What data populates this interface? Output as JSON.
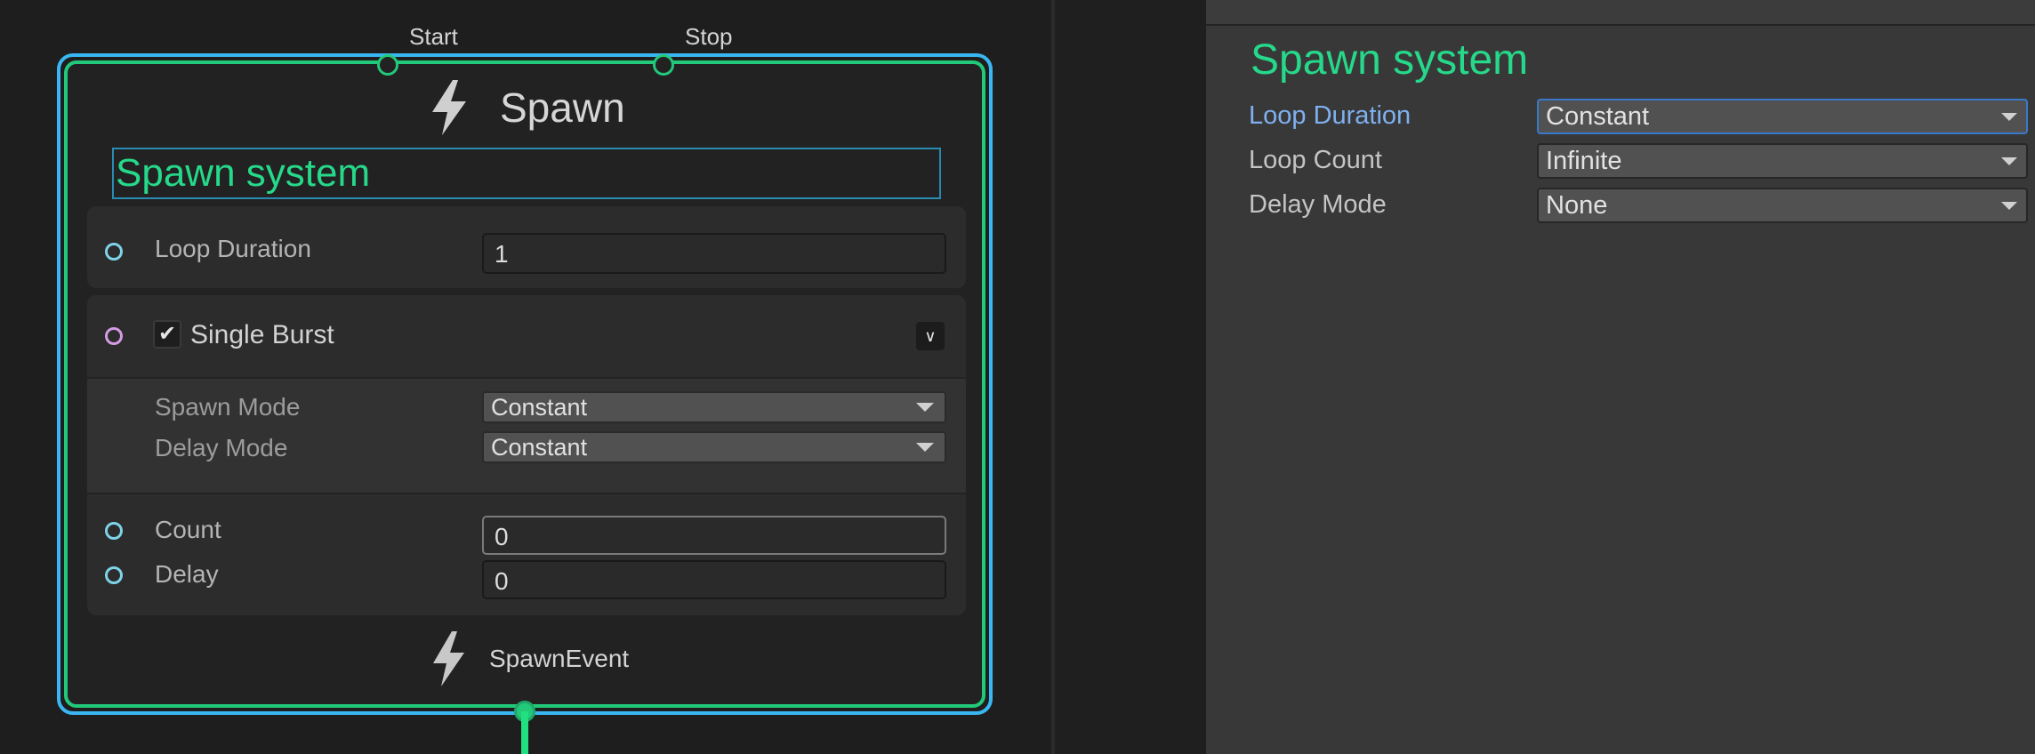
{
  "node": {
    "ports": {
      "start_label": "Start",
      "stop_label": "Stop"
    },
    "title": "Spawn",
    "system_name": "Spawn system",
    "loop_duration": {
      "label": "Loop Duration",
      "value": "1"
    },
    "burst": {
      "label": "Single Burst",
      "checked": true,
      "spawn_mode": {
        "label": "Spawn Mode",
        "value": "Constant"
      },
      "delay_mode": {
        "label": "Delay Mode",
        "value": "Constant"
      },
      "count": {
        "label": "Count",
        "value": "0"
      },
      "delay": {
        "label": "Delay",
        "value": "0"
      }
    },
    "output_label": "SpawnEvent"
  },
  "inspector": {
    "title": "Spawn system",
    "rows": [
      {
        "label": "Loop Duration",
        "value": "Constant"
      },
      {
        "label": "Loop Count",
        "value": "Infinite"
      },
      {
        "label": "Delay Mode",
        "value": "None"
      }
    ]
  },
  "icons": {
    "spawn": "lightning-bolt-icon",
    "output": "lightning-bolt-icon",
    "checkbox": "checkmark-icon",
    "collapse": "chevron-down-icon",
    "dropdown": "triangle-down-icon"
  },
  "colors": {
    "node_outline": "#22c97a",
    "selection_outline": "#3ab7f2",
    "system_name": "#26d98a",
    "active_label": "#7fb0f0"
  }
}
